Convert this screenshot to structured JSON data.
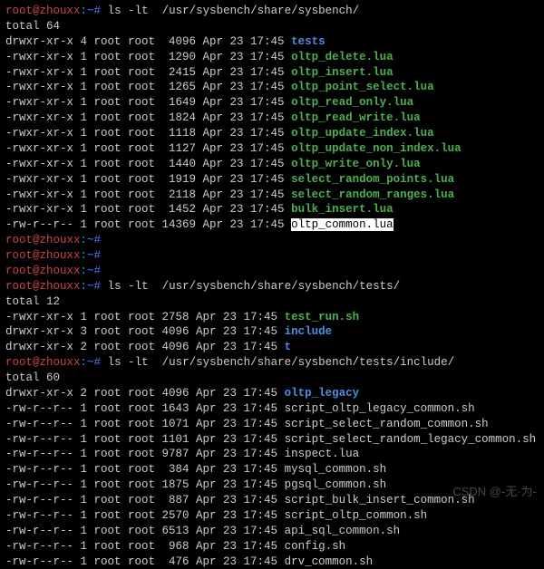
{
  "prompt": {
    "user": "root",
    "at": "@",
    "host": "zhouxx",
    "sep": ":~# "
  },
  "cmd1": {
    "cmd": "ls -lt  /usr/sysbench/share/sysbench/"
  },
  "total1": "total 64",
  "dir1": [
    {
      "perm": "drwxr-xr-x 4 root root  4096 Apr 23 17:45 ",
      "name": "tests",
      "cls": "dir"
    },
    {
      "perm": "-rwxr-xr-x 1 root root  1290 Apr 23 17:45 ",
      "name": "oltp_delete.lua",
      "cls": "exe"
    },
    {
      "perm": "-rwxr-xr-x 1 root root  2415 Apr 23 17:45 ",
      "name": "oltp_insert.lua",
      "cls": "exe"
    },
    {
      "perm": "-rwxr-xr-x 1 root root  1265 Apr 23 17:45 ",
      "name": "oltp_point_select.lua",
      "cls": "exe"
    },
    {
      "perm": "-rwxr-xr-x 1 root root  1649 Apr 23 17:45 ",
      "name": "oltp_read_only.lua",
      "cls": "exe"
    },
    {
      "perm": "-rwxr-xr-x 1 root root  1824 Apr 23 17:45 ",
      "name": "oltp_read_write.lua",
      "cls": "exe"
    },
    {
      "perm": "-rwxr-xr-x 1 root root  1118 Apr 23 17:45 ",
      "name": "oltp_update_index.lua",
      "cls": "exe"
    },
    {
      "perm": "-rwxr-xr-x 1 root root  1127 Apr 23 17:45 ",
      "name": "oltp_update_non_index.lua",
      "cls": "exe"
    },
    {
      "perm": "-rwxr-xr-x 1 root root  1440 Apr 23 17:45 ",
      "name": "oltp_write_only.lua",
      "cls": "exe"
    },
    {
      "perm": "-rwxr-xr-x 1 root root  1919 Apr 23 17:45 ",
      "name": "select_random_points.lua",
      "cls": "exe"
    },
    {
      "perm": "-rwxr-xr-x 1 root root  2118 Apr 23 17:45 ",
      "name": "select_random_ranges.lua",
      "cls": "exe"
    },
    {
      "perm": "-rwxr-xr-x 1 root root  1452 Apr 23 17:45 ",
      "name": "bulk_insert.lua",
      "cls": "exe"
    },
    {
      "perm": "-rw-r--r-- 1 root root 14369 Apr 23 17:45 ",
      "name": "oltp_common.lua",
      "cls": "sel"
    }
  ],
  "cmd2": {
    "cmd": "ls -lt  /usr/sysbench/share/sysbench/tests/"
  },
  "total2": "total 12",
  "dir2": [
    {
      "perm": "-rwxr-xr-x 1 root root 2758 Apr 23 17:45 ",
      "name": "test_run.sh",
      "cls": "exe"
    },
    {
      "perm": "drwxr-xr-x 3 root root 4096 Apr 23 17:45 ",
      "name": "include",
      "cls": "dir"
    },
    {
      "perm": "drwxr-xr-x 2 root root 4096 Apr 23 17:45 ",
      "name": "t",
      "cls": "dir"
    }
  ],
  "cmd3": {
    "cmd": "ls -lt  /usr/sysbench/share/sysbench/tests/include/"
  },
  "total3": "total 60",
  "dir3": [
    {
      "perm": "drwxr-xr-x 2 root root 4096 Apr 23 17:45 ",
      "name": "oltp_legacy",
      "cls": "dir"
    },
    {
      "perm": "-rw-r--r-- 1 root root 1643 Apr 23 17:45 ",
      "name": "script_oltp_legacy_common.sh",
      "cls": "file"
    },
    {
      "perm": "-rw-r--r-- 1 root root 1071 Apr 23 17:45 ",
      "name": "script_select_random_common.sh",
      "cls": "file"
    },
    {
      "perm": "-rw-r--r-- 1 root root 1101 Apr 23 17:45 ",
      "name": "script_select_random_legacy_common.sh",
      "cls": "file"
    },
    {
      "perm": "-rw-r--r-- 1 root root 9787 Apr 23 17:45 ",
      "name": "inspect.lua",
      "cls": "file"
    },
    {
      "perm": "-rw-r--r-- 1 root root  384 Apr 23 17:45 ",
      "name": "mysql_common.sh",
      "cls": "file"
    },
    {
      "perm": "-rw-r--r-- 1 root root 1875 Apr 23 17:45 ",
      "name": "pgsql_common.sh",
      "cls": "file"
    },
    {
      "perm": "-rw-r--r-- 1 root root  887 Apr 23 17:45 ",
      "name": "script_bulk_insert_common.sh",
      "cls": "file"
    },
    {
      "perm": "-rw-r--r-- 1 root root 2570 Apr 23 17:45 ",
      "name": "script_oltp_common.sh",
      "cls": "file"
    },
    {
      "perm": "-rw-r--r-- 1 root root 6513 Apr 23 17:45 ",
      "name": "api_sql_common.sh",
      "cls": "file"
    },
    {
      "perm": "-rw-r--r-- 1 root root  968 Apr 23 17:45 ",
      "name": "config.sh",
      "cls": "file"
    },
    {
      "perm": "-rw-r--r-- 1 root root  476 Apr 23 17:45 ",
      "name": "drv_common.sh",
      "cls": "file"
    }
  ],
  "watermark": "CSDN @-无·为-"
}
